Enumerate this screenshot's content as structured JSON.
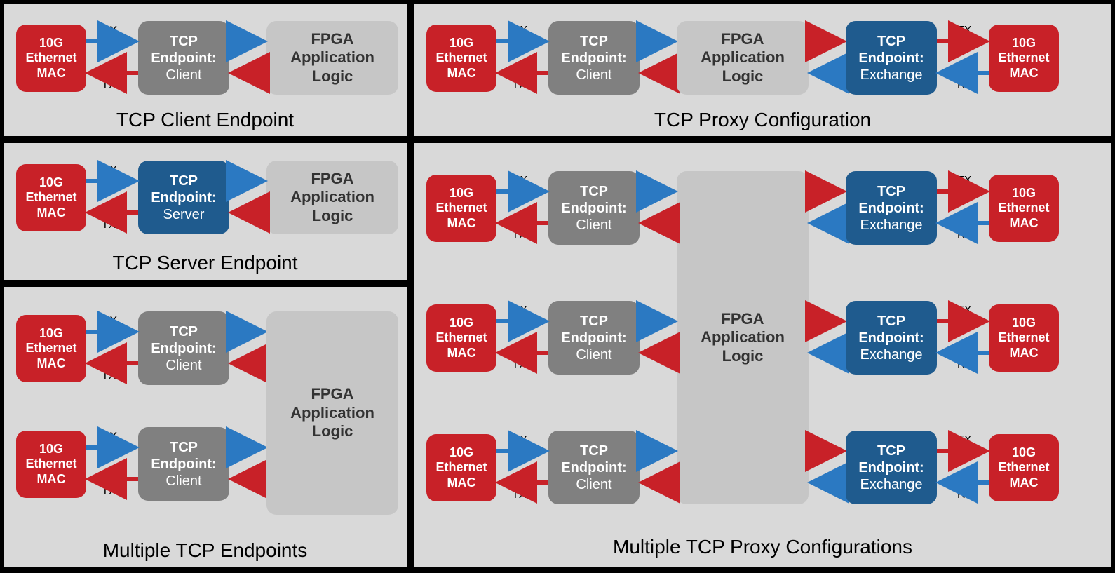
{
  "labels": {
    "mac": "10G\nEthernet\nMAC",
    "tcp": "TCP\nEndpoint:",
    "tcp_client_sub": "Client",
    "tcp_server_sub": "Server",
    "tcp_exchange_sub": "Exchange",
    "fpga": "FPGA\nApplication\nLogic",
    "rx": "RX",
    "tx": "TX"
  },
  "captions": {
    "client": "TCP Client Endpoint",
    "server": "TCP Server Endpoint",
    "multi_endpoints": "Multiple TCP Endpoints",
    "proxy": "TCP Proxy Configuration",
    "multi_proxy": "Multiple TCP Proxy Configurations"
  },
  "colors": {
    "mac": "#c82128",
    "tcp_client": "#808080",
    "tcp_server": "#1f5b8e",
    "fpga": "#c6c6c6",
    "arrow_blue": "#2b79c2",
    "arrow_red": "#c82128"
  }
}
